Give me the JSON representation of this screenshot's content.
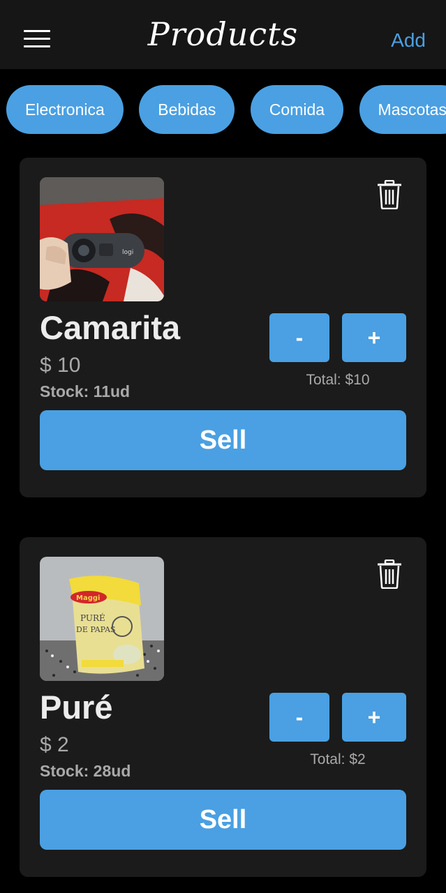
{
  "header": {
    "title": "Products",
    "add_label": "Add"
  },
  "categories": [
    "Electronica",
    "Bebidas",
    "Comida",
    "Mascotas"
  ],
  "products": [
    {
      "name": "Camarita",
      "price": "$ 10",
      "stock": "Stock: 11ud",
      "minus_label": "-",
      "plus_label": "+",
      "total": "Total: $10",
      "sell_label": "Sell",
      "image_icon": "webcam-photo"
    },
    {
      "name": "Puré",
      "price": "$ 2",
      "stock": "Stock: 28ud",
      "minus_label": "-",
      "plus_label": "+",
      "total": "Total: $2",
      "sell_label": "Sell",
      "image_icon": "pure-de-papas-bag-photo"
    }
  ],
  "colors": {
    "accent": "#4aa0e2",
    "background": "#000000",
    "bar": "#161616",
    "card": "#1b1b1b"
  }
}
